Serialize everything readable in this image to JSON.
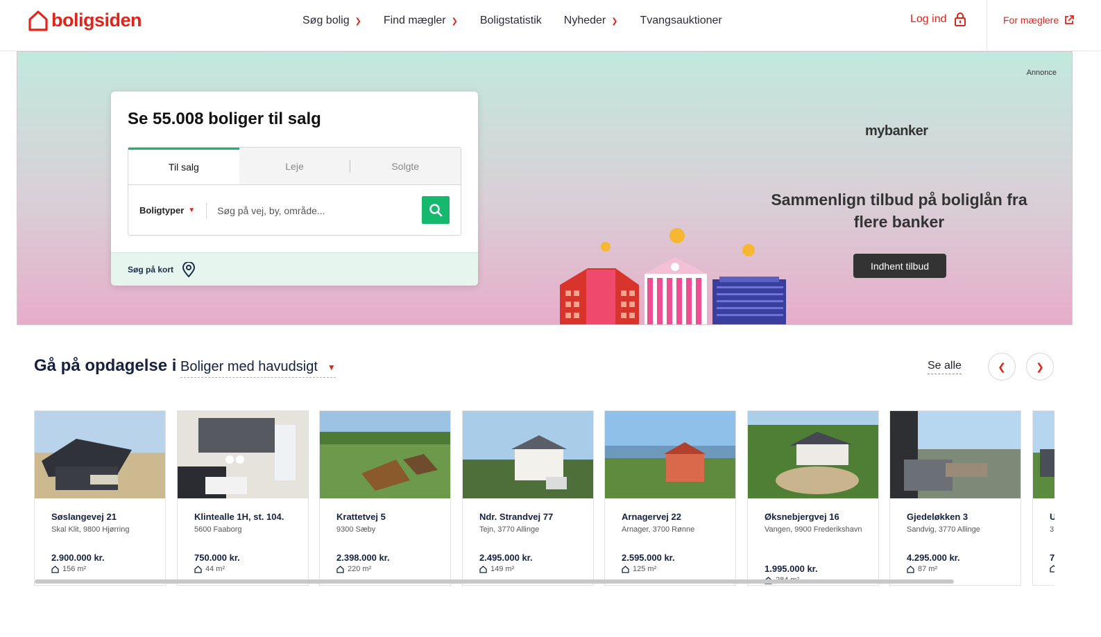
{
  "header": {
    "logo_text": "boligsiden",
    "nav": [
      {
        "label": "Søg bolig",
        "has_dropdown": true
      },
      {
        "label": "Find mægler",
        "has_dropdown": true
      },
      {
        "label": "Boligstatistik",
        "has_dropdown": false
      },
      {
        "label": "Nyheder",
        "has_dropdown": true
      },
      {
        "label": "Tvangsauktioner",
        "has_dropdown": false
      }
    ],
    "login_label": "Log ind",
    "brokers_label": "For mæglere",
    "brand_color": "#e2231a"
  },
  "hero": {
    "annonce_label": "Annonce",
    "search_title": "Se 55.008 boliger til salg",
    "tabs": [
      "Til salg",
      "Leje",
      "Solgte"
    ],
    "active_tab": "Til salg",
    "types_label": "Boligtyper",
    "search_placeholder": "Søg på vej, by, område...",
    "map_label": "Søg på kort",
    "accent_color": "#15b86d"
  },
  "ad": {
    "brand": "mybanker",
    "headline": "Sammenlign tilbud på boliglån fra flere banker",
    "button_label": "Indhent tilbud"
  },
  "discovery": {
    "title": "Gå på opdagelse i",
    "selected_category": "Boliger med havudsigt",
    "see_all_label": "Se alle",
    "prev_icon": "chevron-left-icon",
    "next_icon": "chevron-right-icon"
  },
  "listings": [
    {
      "address": "Søslangevej 21",
      "city": "Skal Klit, 9800 Hjørring",
      "price": "2.900.000 kr.",
      "area": "156 m²"
    },
    {
      "address": "Klintealle 1H, st. 104.",
      "city": "5600 Faaborg",
      "price": "750.000 kr.",
      "area": "44 m²"
    },
    {
      "address": "Krattetvej 5",
      "city": "9300 Sæby",
      "price": "2.398.000 kr.",
      "area": "220 m²"
    },
    {
      "address": "Ndr. Strandvej 77",
      "city": "Tejn, 3770 Allinge",
      "price": "2.495.000 kr.",
      "area": "149 m²"
    },
    {
      "address": "Arnagervej 22",
      "city": "Arnager, 3700 Rønne",
      "price": "2.595.000 kr.",
      "area": "125 m²"
    },
    {
      "address": "Øksnebjergvej 16",
      "city": "Vangen, 9900 Frederikshavn",
      "price": "1.995.000 kr.",
      "area": "284 m²"
    },
    {
      "address": "Gjedeløkken 3",
      "city": "Sandvig, 3770 Allinge",
      "price": "4.295.000 kr.",
      "area": "87 m²"
    },
    {
      "address": "U",
      "city": "3",
      "price": "7",
      "area": ""
    }
  ]
}
